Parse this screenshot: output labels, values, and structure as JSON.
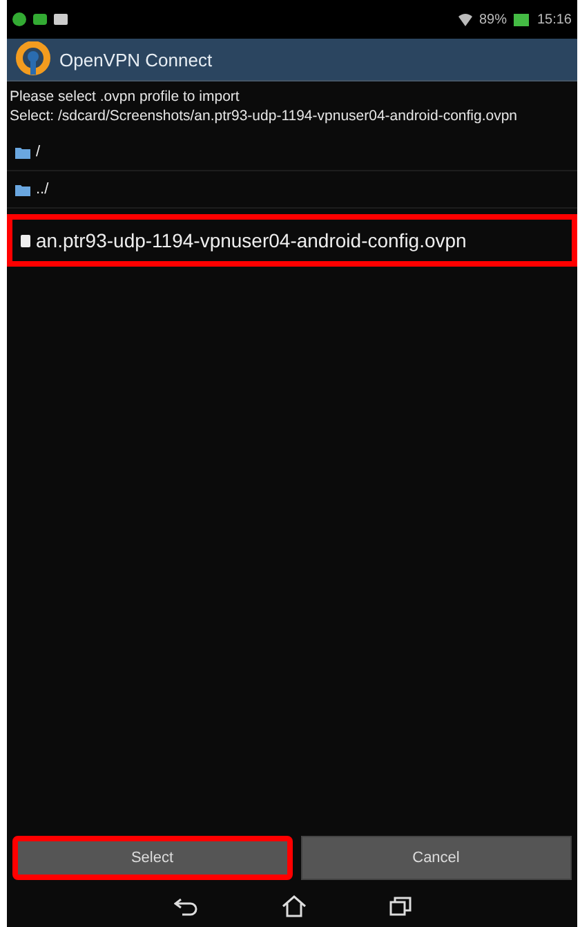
{
  "status_bar": {
    "battery": "89%",
    "time": "15:16"
  },
  "app_bar": {
    "title": "OpenVPN Connect"
  },
  "prompt": "Please select .ovpn profile to import",
  "selection": "Select: /sdcard/Screenshots/an.ptr93-udp-1194-vpnuser04-android-config.ovpn",
  "entries": [
    {
      "kind": "folder",
      "name": "/",
      "highlighted": false
    },
    {
      "kind": "folder",
      "name": "../",
      "highlighted": false
    },
    {
      "kind": "file",
      "name": "an.ptr93-udp-1194-vpnuser04-android-config.ovpn",
      "highlighted": true
    }
  ],
  "buttons": [
    {
      "label": "Select",
      "highlighted": true
    },
    {
      "label": "Cancel",
      "highlighted": false
    }
  ]
}
